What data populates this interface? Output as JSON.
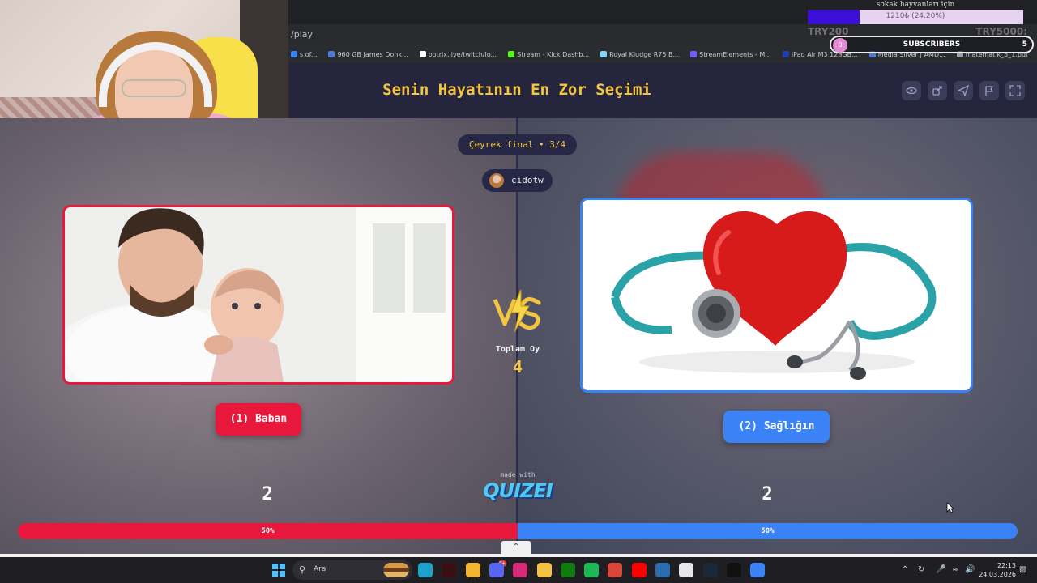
{
  "browser": {
    "url_fragment": "/play",
    "bookmarks": [
      {
        "label": "s of...",
        "color": "#3b82f6"
      },
      {
        "label": "960 GB James Donk...",
        "color": "#4b7bd8"
      },
      {
        "label": "botrix.live/twitch/lo...",
        "color": "#ffffff"
      },
      {
        "label": "Stream - Kick Dashb...",
        "color": "#53fc18"
      },
      {
        "label": "Royal Kludge R75 B...",
        "color": "#7dd3fc"
      },
      {
        "label": "StreamElements - M...",
        "color": "#6d5dfc"
      },
      {
        "label": "iPad Air M3 128GB...",
        "color": "#1e40af"
      },
      {
        "label": "Media Silver | AMD...",
        "color": "#4b7bd8"
      },
      {
        "label": "matematik_5_1.pdf",
        "color": "#9ca3af"
      }
    ]
  },
  "overlay": {
    "donation_title": "sokak hayvanları için",
    "donation_progress_fraction": 0.242,
    "donation_text": "1210₺ (24.20%)",
    "donation_left": "TRY200",
    "donation_right": "TRY5000:",
    "subs_current": "0",
    "subs_label": "SUBSCRIBERS",
    "subs_goal": "5"
  },
  "quiz": {
    "title": "Senin Hayatının En Zor Seçimi",
    "stage": "Çeyrek final • 3/4",
    "username": "cidotw",
    "total_votes_label": "Toplam Oy",
    "total_votes": "4",
    "option_left": {
      "label": "(1) Baban",
      "votes": "2",
      "percent_label": "50%",
      "percent": 50,
      "color": "#e8183c"
    },
    "option_right": {
      "label": "(2) Sağlığın",
      "votes": "2",
      "percent_label": "50%",
      "percent": 50,
      "color": "#3b82f6"
    },
    "made_with": "made with",
    "brand": "QUIZEI"
  },
  "header_icons": [
    "eye-icon",
    "share-icon",
    "send-icon",
    "flag-icon",
    "fullscreen-icon"
  ],
  "taskbar": {
    "search_label": "Ara",
    "time": "22:13",
    "date": "24.03.2026",
    "apps": [
      {
        "name": "edge-icon",
        "color": "#1fa2c8"
      },
      {
        "name": "app-dark-icon",
        "color": "#3a0f14"
      },
      {
        "name": "chrome-icon",
        "color": "#f2b630"
      },
      {
        "name": "discord-icon",
        "color": "#5865f2"
      },
      {
        "name": "instagram-icon",
        "color": "#d62976"
      },
      {
        "name": "folder-icon",
        "color": "#f3c242"
      },
      {
        "name": "xbox-icon",
        "color": "#107c10"
      },
      {
        "name": "spotify-icon",
        "color": "#1db954"
      },
      {
        "name": "chrome-alt-icon",
        "color": "#d9463a"
      },
      {
        "name": "youtube-icon",
        "color": "#ff0000"
      },
      {
        "name": "mail-icon",
        "color": "#2b6cb0"
      },
      {
        "name": "notepad-icon",
        "color": "#e5e7eb"
      },
      {
        "name": "steam-icon",
        "color": "#1b2838"
      },
      {
        "name": "tiktok-icon",
        "color": "#111111"
      },
      {
        "name": "app-blue-icon",
        "color": "#3b82f6"
      }
    ],
    "badge": "9+"
  }
}
